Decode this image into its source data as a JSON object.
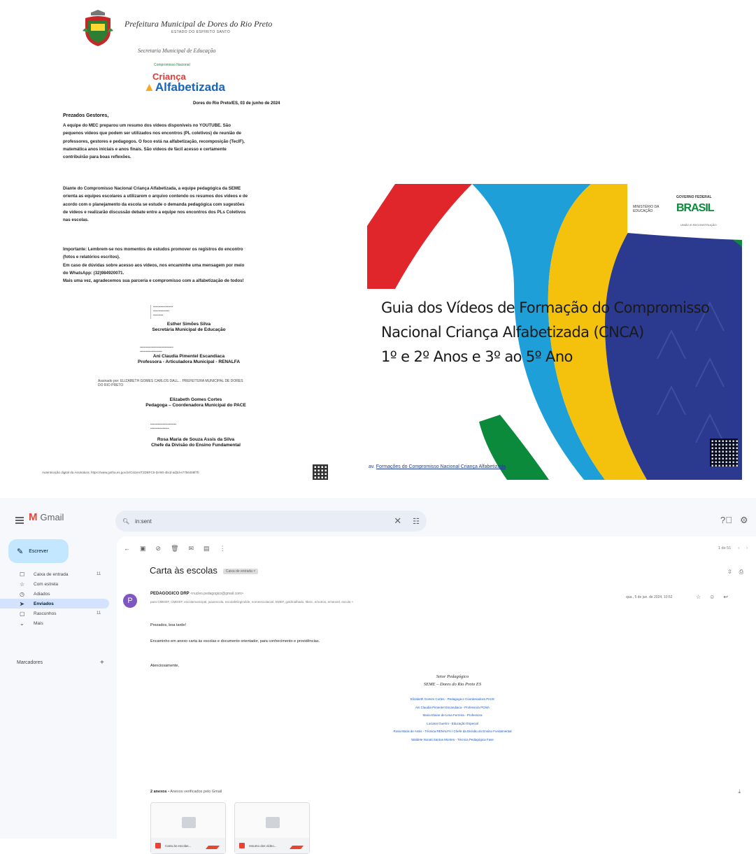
{
  "letter": {
    "header_title": "Prefeitura Municipal de Dores do Rio Preto",
    "header_state": "ESTADO DO ESPÍRITO SANTO",
    "secretariat": "Secretaria Municipal de Educação",
    "logo_small": "Compromisso Nacional",
    "logo_crianca": "Criança",
    "logo_alfabetizada": "Alfabetizada",
    "date_line": "Dores do Rio Preto/ES, 03 de junho de 2024",
    "greeting": "Prezados Gestores,",
    "paragraph1": [
      "A equipe do MEC preparou um resumo dos vídeos disponíveis no YOUTUBE. São",
      "pequenos vídeos que podem ser utilizados nos encontros (PL coletivos) de reunião de",
      "professores, gestores e pedagogos. O foco está na alfabetização, recomposição (TecIF),",
      "matemática anos iniciais e anos finais. São vídeos de fácil acesso e certamente",
      "contribuirão para boas reflexões."
    ],
    "paragraph2": [
      "Diante do Compromisso Nacional Criança Alfabetizada, a equipe pedagógica da SEME",
      "orienta as equipes escolares a utilizarem o arquivo contendo os resumos dos vídeos e de",
      "acordo com o planejamento da escola se estude o demanda pedagógica com sugestões",
      "de vídeos e realizarão discussão debate entre a equipe nos encontros dos PLs Coletivos",
      "nas escolas."
    ],
    "paragraph3": [
      "Importante: Lembrem-se nos momentos de estudos promover os registros do encontro",
      "(fotos e relatórios escritos).",
      "Em caso de dúvidas sobre acesso aos vídeos, nos encaminhe uma mensagem por meio",
      "do WhatsApp: (32)984920071.",
      "Mais uma vez, agradecemos sua parceria e compromisso com a alfabetização de todos!"
    ],
    "signatures": [
      {
        "name": "Esther Simões Silva",
        "role": "Secretária Municipal de Educação"
      },
      {
        "name": "Ani Claudia Pimentel Escandiaca",
        "role": "Professora - Articuladora Municipal - RENALFA"
      },
      {
        "name": "Elizabeth Gomes Cortes",
        "role": "Pedagoga – Coordenadora Municipal do PACE"
      },
      {
        "name": "Rosa Maria de Souza Assis da Silva",
        "role": "Chefe da Divisão do Ensino Fundamental"
      }
    ],
    "elizabeth_stamp": "Assinado por: ELIZABETH GOMES CARLOS DALL... PREFEITURA MUNICIPAL DE DORES DO RIO PRETO",
    "footer": "Autenticação digital da Assinatura: https://www.gotha.es.gov.br/Citizen/T2DBFC5-DA90-4bcd-ad3d-e7756458f7b"
  },
  "slide": {
    "title_lines": [
      "Guia dos Vídeos de Formação do Compromisso",
      "Nacional Criança Alfabetizada (CNCA)",
      "1º e 2º Anos e 3º ao 5º Ano"
    ],
    "gov_label": "GOVERNO FEDERAL",
    "ministry": "MINISTÉRIO DA EDUCAÇÃO",
    "brasil_logo": "BRASIL",
    "brasil_sub": "UNIÃO E RECONSTRUÇÃO",
    "link_prefix": "av.",
    "link_text": "Formações do Compromisso Nacional Criança Alfabetizada",
    "colors": {
      "red": "#e0262a",
      "blue": "#1f9fd8",
      "yellow": "#f4c20d",
      "navy": "#2b3a8f",
      "green": "#0a8a3a"
    }
  },
  "gmail": {
    "app_name": "Gmail",
    "search_value": "in:sent",
    "compose_label": "Escrever",
    "nav": [
      {
        "icon": "inbox-icon",
        "glyph": "☐",
        "label": "Caixa de entrada",
        "count": "11"
      },
      {
        "icon": "star-icon",
        "glyph": "☆",
        "label": "Com estrela",
        "count": ""
      },
      {
        "icon": "clock-icon",
        "glyph": "◷",
        "label": "Adiados",
        "count": ""
      },
      {
        "icon": "send-icon",
        "glyph": "➤",
        "label": "Enviados",
        "count": ""
      },
      {
        "icon": "draft-icon",
        "glyph": "▢",
        "label": "Rascunhos",
        "count": "11"
      },
      {
        "icon": "chevron-down-icon",
        "glyph": "⌄",
        "label": "Mais",
        "count": ""
      }
    ],
    "labels_heading": "Marcadores",
    "pager": "1 de 51",
    "subject": "Carta às escolas",
    "label_chip": "Caixa de entrada ×",
    "sender_name": "PEDAGOGICO DRP",
    "sender_email": "<nucleo.pedagogico@gmail.com>",
    "recipients": "para CMEIEF, CMEIEF, escolamunicipal, joaoescola, escolafelizgiroilde, nomeescolacarl, EMEF, goldmalhado, ltbsrc, e/outros, emanoel, escola +",
    "date": "qua., 5 de jun. de 2024, 10:52",
    "greeting": "Prezados, boa tarde!",
    "body": "Encaminho em anexo carta às escolas e documento orientador, para conhecimento e providências.",
    "closing": "Atenciosamente,",
    "signature_title": "Setor Pedagógico",
    "signature_org": "SEME – Dores do Rio Preto ES",
    "signature_people": [
      "Elizabeth Gomes Cortes - Pedagoga e Coordenadora PACE",
      "Ani Claudia Pimentel Escandiaca - Professora PCMA",
      "Maria Elaine de Lima Ferreira - Professora",
      "Luciana Guerini - Educação Especial",
      "Rosa Maria de Assis - Técnica RENALFA / Chefe da Divisão do Ensino Fundamental",
      "Waldete Nonati Santos Montes - Técnica Pedagógica Fase"
    ],
    "attach_count": "2 anexos",
    "attach_note": "• Anexos verificados pelo Gmail",
    "attachments": [
      {
        "name": "Carta às escolas..."
      },
      {
        "name": "resumo dos vídeo..."
      }
    ]
  }
}
